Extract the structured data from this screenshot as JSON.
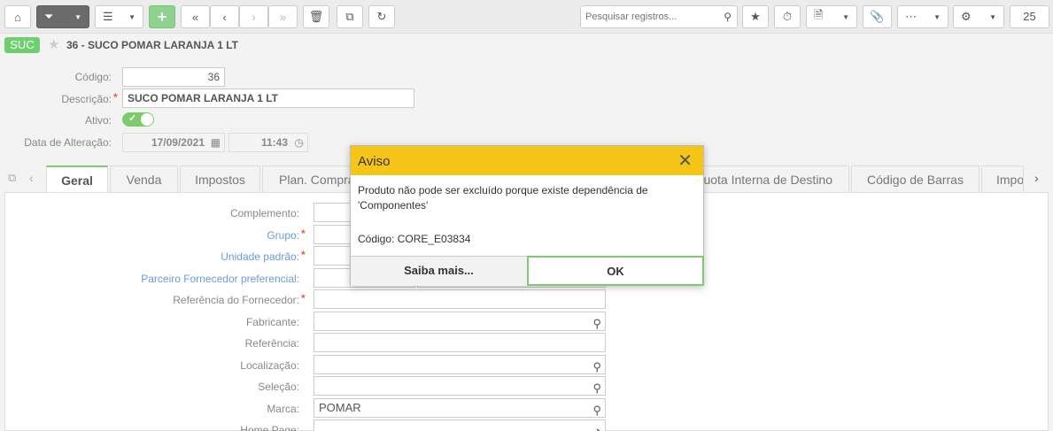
{
  "toolbar": {
    "search_placeholder": "Pesquisar registros...",
    "page_size": "25"
  },
  "record": {
    "module_badge": "SUC",
    "title": "36 - SUCO POMAR LARANJA 1 LT"
  },
  "header_form": {
    "codigo_label": "Código:",
    "codigo_value": "36",
    "descricao_label": "Descrição:",
    "descricao_value": "SUCO POMAR LARANJA 1 LT",
    "ativo_label": "Ativo:",
    "ativo_value": true,
    "data_alteracao_label": "Data de Alteração:",
    "data_alteracao_date": "17/09/2021",
    "data_alteracao_time": "11:43"
  },
  "tabs": [
    {
      "label": "Geral",
      "active": true
    },
    {
      "label": "Venda"
    },
    {
      "label": "Impostos"
    },
    {
      "label": "Plan. Compras"
    },
    {
      "label": "Alíquota Interna de Destino"
    },
    {
      "label": "Código de Barras"
    },
    {
      "label": "Impo"
    }
  ],
  "fields": [
    {
      "label": "Complemento:",
      "value": "",
      "link": false
    },
    {
      "label": "Grupo:",
      "value": "",
      "link": true,
      "required": true
    },
    {
      "label": "Unidade padrão:",
      "value": "",
      "link": true,
      "required": true
    },
    {
      "label": "Parceiro Fornecedor preferencial:",
      "value": "",
      "link": true
    },
    {
      "label": "Referência do Fornecedor:",
      "value": "",
      "link": false,
      "required": true
    },
    {
      "label": "Fabricante:",
      "value": "",
      "link": false,
      "lookup": true
    },
    {
      "label": "Referência:",
      "value": "",
      "link": false
    },
    {
      "label": "Localização:",
      "value": "",
      "link": false,
      "lookup": true
    },
    {
      "label": "Seleção:",
      "value": "",
      "link": false,
      "lookup": true
    },
    {
      "label": "Marca:",
      "value": "POMAR",
      "link": false,
      "lookup": true
    },
    {
      "label": "Home Page:",
      "value": "",
      "link": false
    }
  ],
  "dialog": {
    "title": "Aviso",
    "message": "Produto não pode ser excluído porque existe dependência de 'Componentes'",
    "code": "Código: CORE_E03834",
    "secondary_label": "Saiba mais...",
    "primary_label": "OK"
  },
  "colors": {
    "accent_green": "#7ccc6e",
    "dialog_header": "#f5c518",
    "link_blue": "#6b9bd6",
    "required_red": "#e15b4f"
  }
}
